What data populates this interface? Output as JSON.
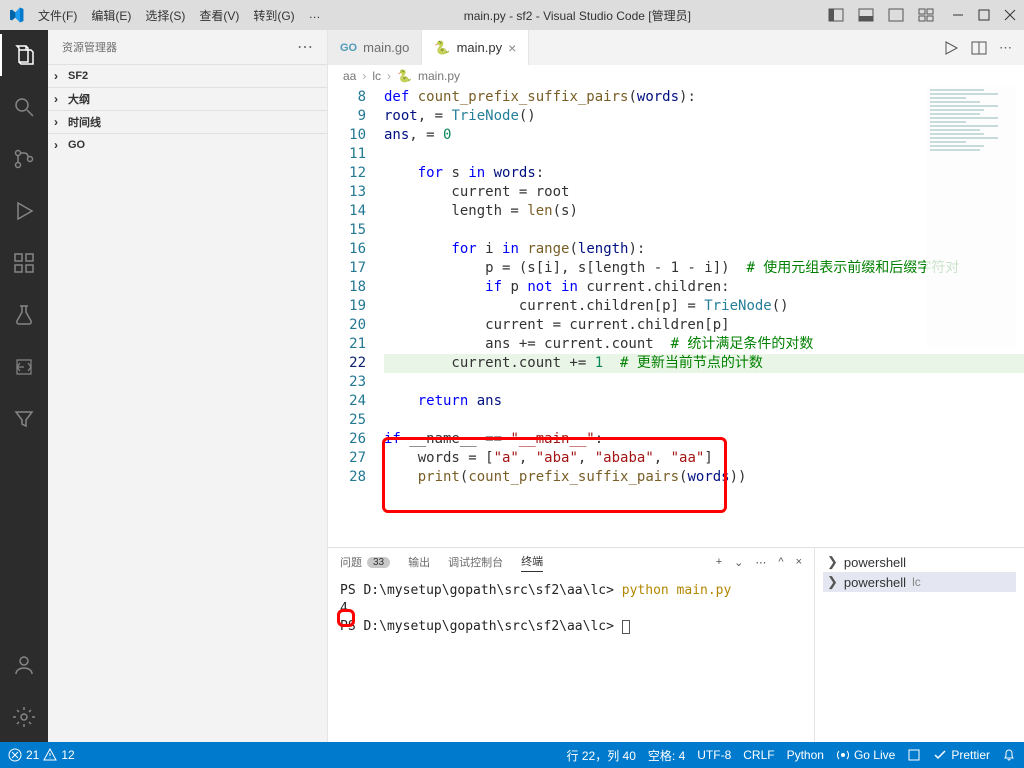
{
  "title": "main.py - sf2 - Visual Studio Code [管理员]",
  "menus": [
    "文件(F)",
    "编辑(E)",
    "选择(S)",
    "查看(V)",
    "转到(G)",
    "…"
  ],
  "sidebar": {
    "header": "资源管理器",
    "sections": [
      "SF2",
      "大纲",
      "时间线",
      "GO"
    ]
  },
  "tabs": [
    {
      "label": "main.go",
      "active": false
    },
    {
      "label": "main.py",
      "active": true
    }
  ],
  "breadcrumbs": [
    "aa",
    "lc",
    "main.py"
  ],
  "gutter": {
    "start": 8,
    "end": 28,
    "current": 22
  },
  "code": [
    {
      "n": 8,
      "t": [
        [
          "k",
          "def"
        ],
        [
          "",
          " "
        ],
        [
          "fn",
          "count_prefix_suffix_pairs"
        ],
        [
          "",
          "("
        ],
        [
          "v",
          "words"
        ],
        [
          "",
          "):"
        ]
      ],
      "indent": 0
    },
    {
      "n": 9,
      "t": [
        [
          "v",
          "root"
        ],
        [
          "",
          ", = "
        ],
        [
          "cls",
          "TrieNode"
        ],
        [
          "",
          "()"
        ]
      ],
      "raw": "    root = TrieNode()",
      "indent": 1
    },
    {
      "n": 10,
      "t": [
        [
          "v",
          "ans"
        ],
        [
          "",
          ", = "
        ],
        [
          "num",
          "0"
        ]
      ],
      "raw": "    ans = 0",
      "indent": 1
    },
    {
      "n": 11,
      "raw": "",
      "indent": 0
    },
    {
      "n": 12,
      "t": [
        [
          "k",
          "    for"
        ],
        [
          "",
          " s "
        ],
        [
          "k",
          "in"
        ],
        [
          "",
          " "
        ],
        [
          "v",
          "words"
        ],
        [
          "",
          ":"
        ]
      ],
      "indent": 1
    },
    {
      "n": 13,
      "raw": "        current = root",
      "indent": 2
    },
    {
      "n": 14,
      "raw": "        length = len(s)",
      "indent": 2,
      "fn": [
        "len"
      ]
    },
    {
      "n": 15,
      "raw": "",
      "indent": 0
    },
    {
      "n": 16,
      "t": [
        [
          "k",
          "        for"
        ],
        [
          "",
          " i "
        ],
        [
          "k",
          "in"
        ],
        [
          "",
          " "
        ],
        [
          "fn",
          "range"
        ],
        [
          "",
          "("
        ],
        [
          "v",
          "length"
        ],
        [
          "",
          "):"
        ]
      ],
      "indent": 2
    },
    {
      "n": 17,
      "raw": "            p = (s[i], s[length - 1 - i])  ",
      "cmt": "# 使用元组表示前缀和后缀字符对",
      "indent": 3
    },
    {
      "n": 18,
      "t": [
        [
          "k",
          "            if"
        ],
        [
          "",
          " p "
        ],
        [
          "k",
          "not in"
        ],
        [
          "",
          " current.children:"
        ]
      ],
      "indent": 3
    },
    {
      "n": 19,
      "raw": "                current.children[p] = TrieNode()",
      "indent": 4,
      "cls": [
        "TrieNode"
      ]
    },
    {
      "n": 20,
      "raw": "            current = current.children[p]",
      "indent": 3
    },
    {
      "n": 21,
      "raw": "            ans += current.count  ",
      "cmt": "# 统计满足条件的对数",
      "indent": 3
    },
    {
      "n": 22,
      "raw": "        current.count += 1  ",
      "cmt": "# 更新当前节点的计数",
      "indent": 2,
      "modified": true,
      "num": [
        "1"
      ]
    },
    {
      "n": 23,
      "raw": "",
      "indent": 0
    },
    {
      "n": 24,
      "t": [
        [
          "k",
          "    return"
        ],
        [
          "",
          " "
        ],
        [
          "v",
          "ans"
        ]
      ],
      "indent": 1
    },
    {
      "n": 25,
      "raw": "",
      "indent": 0
    },
    {
      "n": 26,
      "t": [
        [
          "k",
          "if"
        ],
        [
          "",
          " __name__ == "
        ],
        [
          "str",
          "\"__main__\""
        ],
        [
          "",
          ":"
        ]
      ],
      "indent": 0
    },
    {
      "n": 27,
      "raw": "    words = [\"a\", \"aba\", \"ababa\", \"aa\"]",
      "indent": 1,
      "str": [
        "\"a\"",
        "\"aba\"",
        "\"ababa\"",
        "\"aa\""
      ]
    },
    {
      "n": 28,
      "t": [
        [
          "",
          "    "
        ],
        [
          "fn",
          "print"
        ],
        [
          "",
          "("
        ],
        [
          "fn",
          "count_prefix_suffix_pairs"
        ],
        [
          "",
          "("
        ],
        [
          "v",
          "words"
        ],
        [
          "",
          "))"
        ]
      ],
      "indent": 1
    }
  ],
  "panel": {
    "tabs": [
      "问题",
      "输出",
      "调试控制台",
      "终端"
    ],
    "badge": "33",
    "active": "终端",
    "terminal": {
      "line1_prompt": "PS D:\\mysetup\\gopath\\src\\sf2\\aa\\lc> ",
      "line1_cmd": "python main.py",
      "output": "4",
      "line3_prompt": "PS D:\\mysetup\\gopath\\src\\sf2\\aa\\lc> "
    },
    "terminals": [
      {
        "name": "powershell",
        "sub": ""
      },
      {
        "name": "powershell",
        "sub": "lc",
        "sel": true
      }
    ]
  },
  "status": {
    "errors": "21",
    "warnings": "12",
    "pos": "行 22，列 40",
    "spaces": "空格: 4",
    "encoding": "UTF-8",
    "eol": "CRLF",
    "lang": "Python",
    "golive": "Go Live",
    "prettier": "Prettier"
  }
}
